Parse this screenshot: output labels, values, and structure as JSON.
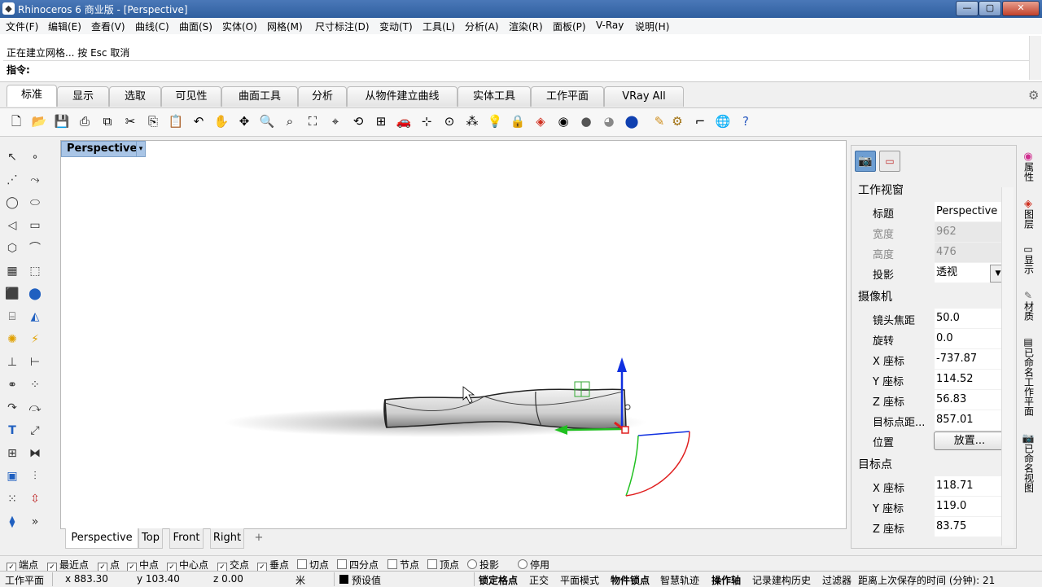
{
  "window": {
    "title": "Rhinoceros 6 商业版 - [Perspective]",
    "min": "—",
    "max": "▢",
    "close": "✕"
  },
  "menu": [
    "文件(F)",
    "编辑(E)",
    "查看(V)",
    "曲线(C)",
    "曲面(S)",
    "实体(O)",
    "网格(M)",
    "尺寸标注(D)",
    "变动(T)",
    "工具(L)",
    "分析(A)",
    "渲染(R)",
    "面板(P)",
    "V-Ray",
    "说明(H)"
  ],
  "command": {
    "history": "正在建立网格... 按 Esc 取消",
    "prompt": "指令:"
  },
  "tabs": [
    "标准",
    "显示",
    "选取",
    "可见性",
    "曲面工具",
    "分析",
    "从物件建立曲线",
    "实体工具",
    "工作平面",
    "VRay All"
  ],
  "viewport": {
    "title": "Perspective",
    "menu_arrow": "▾"
  },
  "view_tabs": [
    "Perspective",
    "Top",
    "Front",
    "Right",
    "+"
  ],
  "panel": {
    "section_view": "工作视窗",
    "rows_view": [
      {
        "k": "标题",
        "v": "Perspective",
        "dim": false
      },
      {
        "k": "宽度",
        "v": "962",
        "dim": true
      },
      {
        "k": "高度",
        "v": "476",
        "dim": true
      },
      {
        "k": "投影",
        "v": "透视",
        "dim": false
      }
    ],
    "section_camera": "摄像机",
    "rows_camera": [
      {
        "k": "镜头焦距",
        "v": "50.0"
      },
      {
        "k": "旋转",
        "v": "0.0"
      },
      {
        "k": "X 座标",
        "v": "-737.87"
      },
      {
        "k": "Y 座标",
        "v": "114.52"
      },
      {
        "k": "Z 座标",
        "v": "56.83"
      },
      {
        "k": "目标点距...",
        "v": "857.01"
      }
    ],
    "position_label": "位置",
    "place_button": "放置...",
    "section_target": "目标点",
    "rows_target": [
      {
        "k": "X 座标",
        "v": "118.71"
      },
      {
        "k": "Y 座标",
        "v": "119.0"
      },
      {
        "k": "Z 座标",
        "v": "83.75"
      }
    ]
  },
  "side_tabs": [
    "属性",
    "图层",
    "显示",
    "材质",
    "已命名工作平面",
    "已命名视图"
  ],
  "osnaps": [
    {
      "label": "端点",
      "checked": true
    },
    {
      "label": "最近点",
      "checked": true
    },
    {
      "label": "点",
      "checked": true
    },
    {
      "label": "中点",
      "checked": true
    },
    {
      "label": "中心点",
      "checked": true
    },
    {
      "label": "交点",
      "checked": true
    },
    {
      "label": "垂点",
      "checked": true
    },
    {
      "label": "切点",
      "checked": false
    },
    {
      "label": "四分点",
      "checked": false
    },
    {
      "label": "节点",
      "checked": false
    },
    {
      "label": "顶点",
      "checked": false
    },
    {
      "label": "投影",
      "checked": false
    },
    {
      "label": "停用",
      "checked": false
    }
  ],
  "status": {
    "plane": "工作平面",
    "x": "x 883.30",
    "y": "y 103.40",
    "z": "z 0.00",
    "unit": "米",
    "layer": "预设值",
    "grid_snap": "锁定格点",
    "ortho": "正交",
    "planar": "平面模式",
    "osnap": "物件锁点",
    "smarttrack": "智慧轨迹",
    "gumball": "操作轴",
    "history": "记录建构历史",
    "filter": "过滤器",
    "saved": "距离上次保存的时间 (分钟): 21"
  },
  "colors": {
    "accent": "#a9c5e6",
    "titlebar": "#3a68aa",
    "axis_x": "#e02020",
    "axis_y": "#20c020",
    "axis_z": "#1030e0"
  }
}
